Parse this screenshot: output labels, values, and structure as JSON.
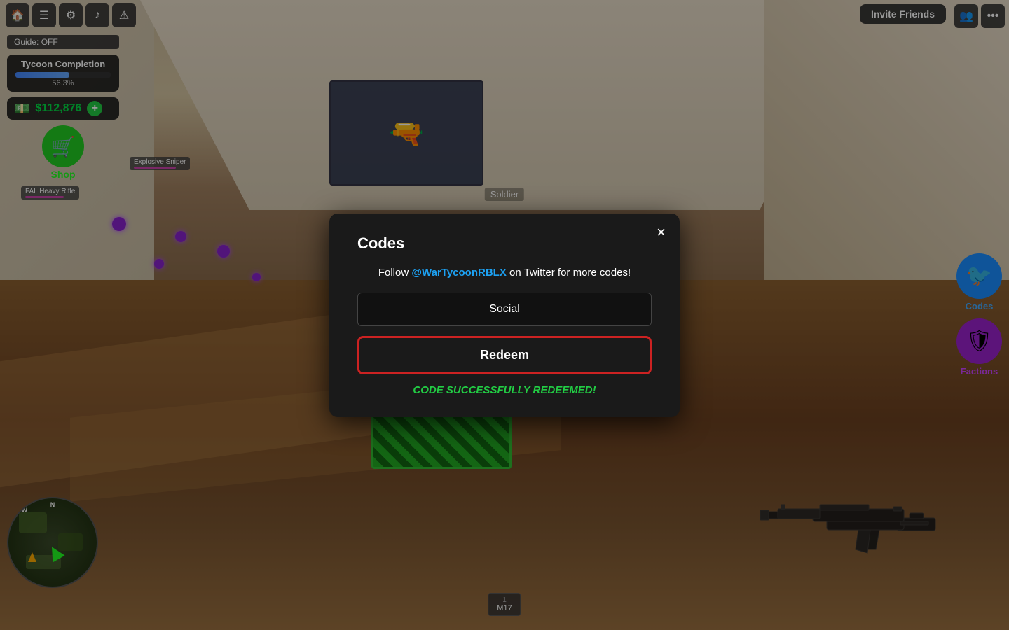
{
  "topbar": {
    "icons": [
      "🏠",
      "☰",
      "⚙",
      "♪",
      "⚠"
    ],
    "invite_friends": "Invite Friends"
  },
  "hud": {
    "guide": "Guide: OFF",
    "tycoon": {
      "title": "Tycoon Completion",
      "percent": "56.3%",
      "fill_width": "56.3%"
    },
    "money": "$112,876",
    "shop_label": "Shop"
  },
  "right_buttons": {
    "codes": {
      "label": "Codes",
      "icon": "🐦"
    },
    "factions": {
      "label": "Factions",
      "icon": "🛡"
    }
  },
  "modal": {
    "title": "Codes",
    "twitter_prompt_prefix": "Follow ",
    "twitter_handle": "@WarTycoonRBLX",
    "twitter_prompt_suffix": " on Twitter for more codes!",
    "input_value": "Social",
    "redeem_label": "Redeem",
    "success_message": "CODE SUCCESSFULLY REDEEMED!",
    "close_label": "×"
  },
  "hotbar": {
    "slot_num": "1",
    "slot_name": "M17"
  },
  "npc_label": "Soldier",
  "weapons": {
    "explosive_sniper": "Explosive Sniper",
    "fal_rifle": "FAL Heavy Rifle"
  }
}
